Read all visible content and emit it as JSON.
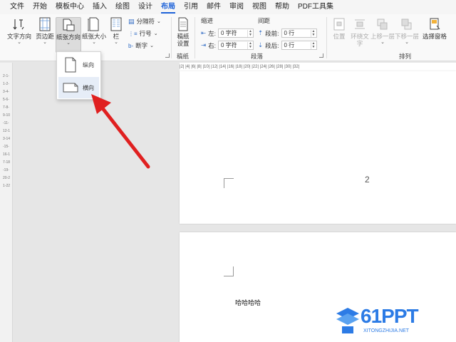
{
  "menu": {
    "tabs": [
      "文件",
      "开始",
      "模板中心",
      "插入",
      "绘图",
      "设计",
      "布局",
      "引用",
      "邮件",
      "审阅",
      "视图",
      "帮助",
      "PDF工具集"
    ],
    "active": "布局"
  },
  "ribbon": {
    "text_direction": "文字方向",
    "margins": "页边距",
    "orientation": "纸张方向",
    "size": "纸张大小",
    "columns": "栏",
    "breaks": "分隔符",
    "line_numbers": "行号",
    "hyphenation": "断字",
    "draft_paper": "稿纸\n设置",
    "draft_group": "稿纸",
    "indent_title": "缩进",
    "spacing_title": "间距",
    "indent_left_label": "左:",
    "indent_left_value": "0 字符",
    "indent_right_label": "右:",
    "indent_right_value": "0 字符",
    "spacing_before_label": "段前:",
    "spacing_before_value": "0 行",
    "spacing_after_label": "段后:",
    "spacing_after_value": "0 行",
    "paragraph_group": "段落",
    "position": "位置",
    "wrap_text": "环绕文\n字",
    "bring_forward": "上移一层",
    "send_backward": "下移一层",
    "selection_pane": "选择窗格",
    "arrange_group": "排列"
  },
  "dropdown": {
    "portrait": "纵向",
    "landscape": "横向"
  },
  "ruler": {
    "marks": "|2|  |4|  |6|  |8|  |10|  |12|  |14|  |16|  |18|  |20|  |22|  |24|  |26|  |28|  |30|  |32|"
  },
  "document": {
    "page_number": "2",
    "body_text": "哈哈哈哈"
  },
  "watermark": {
    "brand": "61PPT",
    "site": "XITONGZHIJIA.NET"
  },
  "colors": {
    "accent": "#1e63d9",
    "arrow": "#e02020",
    "logo": "#2c7be5"
  }
}
